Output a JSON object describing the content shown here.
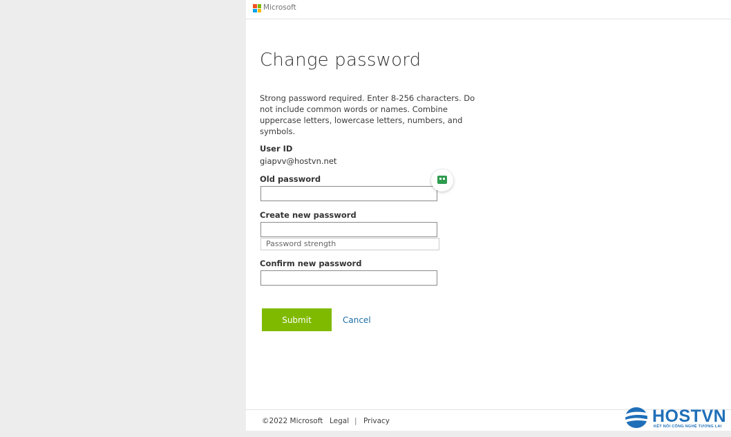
{
  "header": {
    "brand": "Microsoft"
  },
  "page": {
    "title": "Change password",
    "description": "Strong password required. Enter 8-256 characters. Do not include common words or names. Combine uppercase letters, lowercase letters, numbers, and symbols."
  },
  "form": {
    "user_id_label": "User ID",
    "user_id_value": "giapvv@hostvn.net",
    "old_password_label": "Old password",
    "new_password_label": "Create new password",
    "strength_label": "Password strength",
    "confirm_password_label": "Confirm new password",
    "submit_label": "Submit",
    "cancel_label": "Cancel"
  },
  "footer": {
    "copyright": "©2022 Microsoft",
    "legal": "Legal",
    "separator": "|",
    "privacy": "Privacy"
  },
  "watermark": {
    "brand": "HOSTVN",
    "tagline": "KẾT NỐI CÔNG NGHỆ TƯƠNG LAI"
  },
  "colors": {
    "accent_green": "#7fba00",
    "link_blue": "#1d6ea6",
    "watermark_blue": "#1f6fb8"
  },
  "icons": {
    "brand_logo": "microsoft-logo-icon",
    "password_manager": "password-manager-icon",
    "watermark_logo": "hostvn-logo-icon"
  }
}
